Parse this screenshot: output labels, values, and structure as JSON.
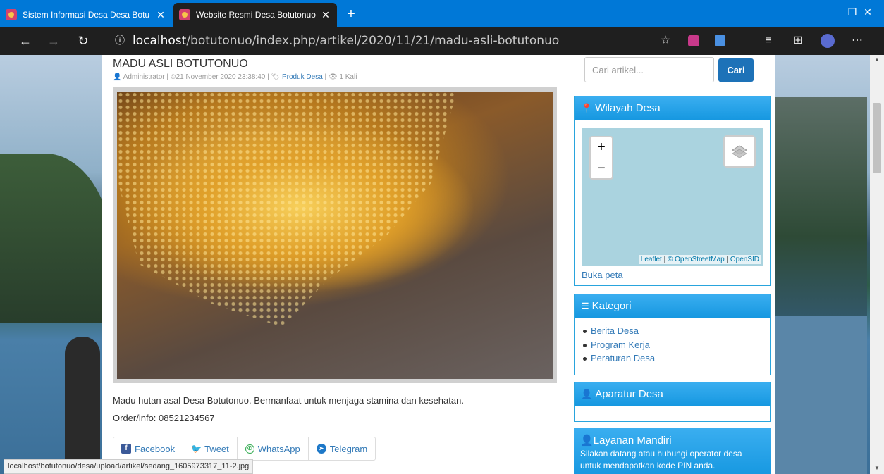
{
  "browser": {
    "tabs": [
      {
        "title": "Sistem Informasi Desa Desa Botu",
        "active": false
      },
      {
        "title": "Website Resmi Desa Botutonuo",
        "active": true
      }
    ],
    "new_tab": "+",
    "url_host": "localhost",
    "url_path": "/botutonuo/index.php/artikel/2020/11/21/madu-asli-botutonuo",
    "status_url": "localhost/botutonuo/desa/upload/artikel/sedang_1605973317_11-2.jpg",
    "accent_color": "#0078d7"
  },
  "article": {
    "title": "MADU ASLI BOTUTONUO",
    "meta_author": "Administrator",
    "meta_date": "21 November 2020 23:38:40",
    "meta_category": "Produk Desa",
    "meta_views": "1 Kali",
    "image_alt": "honeycomb",
    "description": "Madu hutan asal Desa Botutonuo. Bermanfaat untuk menjaga stamina dan kesehatan.",
    "order_info": "Order/info: 08521234567",
    "share": [
      "Facebook",
      "Tweet",
      "WhatsApp",
      "Telegram"
    ]
  },
  "sidebar": {
    "search": {
      "placeholder": "Cari artikel...",
      "button": "Cari"
    },
    "wilayah": {
      "title": "Wilayah Desa",
      "zoom_in": "+",
      "zoom_out": "−",
      "attrib_leaflet": "Leaflet",
      "attrib_osm": "© OpenStreetMap",
      "attrib_opensid": "OpenSID",
      "open_map": "Buka peta"
    },
    "kategori": {
      "title": "Kategori",
      "items": [
        "Berita Desa",
        "Program Kerja",
        "Peraturan Desa"
      ]
    },
    "aparatur": {
      "title": "Aparatur Desa"
    },
    "layanan": {
      "title": "Layanan Mandiri",
      "text": "Silakan datang atau hubungi operator desa untuk mendapatkan kode PIN anda."
    },
    "header_color": "#1597e0"
  }
}
